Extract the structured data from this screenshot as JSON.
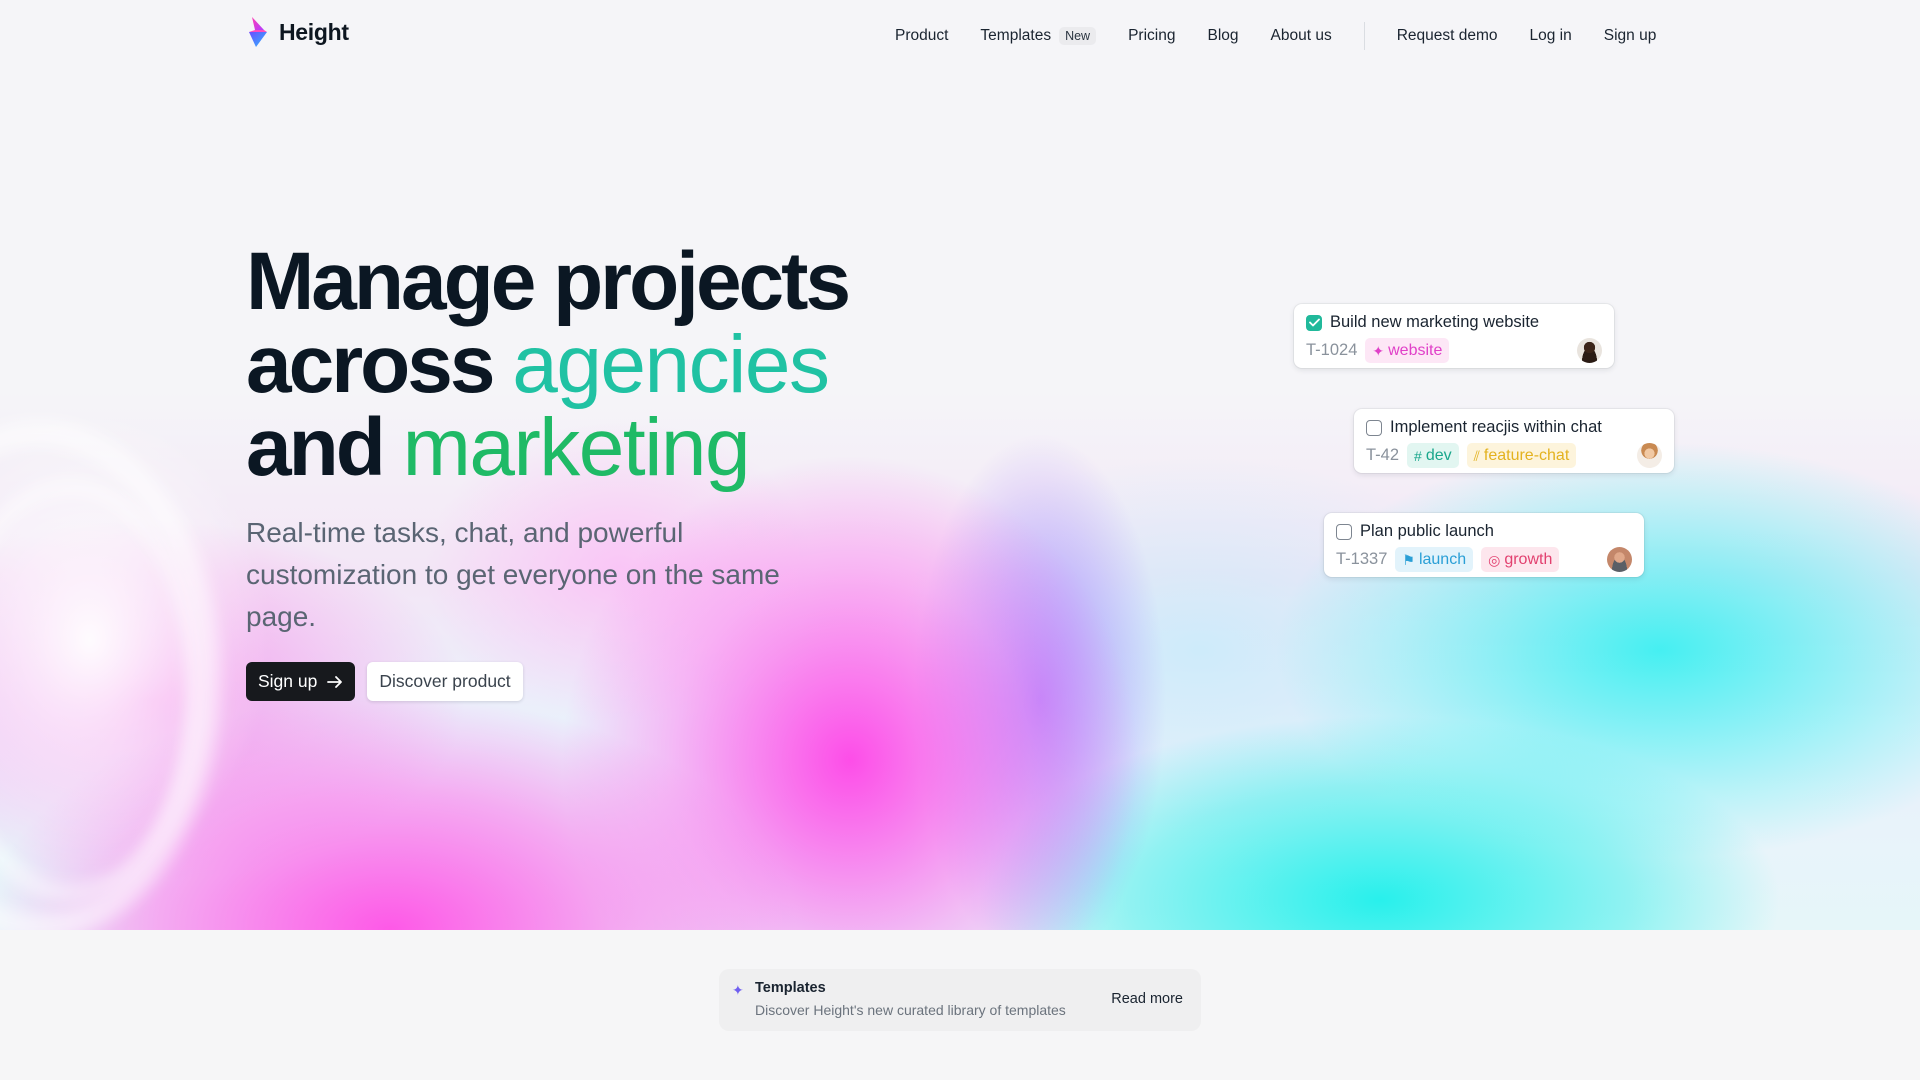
{
  "nav": {
    "brand": "Height",
    "links": {
      "product": "Product",
      "templates": "Templates",
      "templates_badge": "New",
      "pricing": "Pricing",
      "blog": "Blog",
      "about": "About us",
      "request_demo": "Request demo",
      "login": "Log in",
      "signup": "Sign up"
    }
  },
  "hero": {
    "headline": {
      "line1": "Manage projects",
      "line2_strong": "across",
      "line2_accent": "agencies",
      "line3_strong": "and",
      "line3_accent": "marketing"
    },
    "subcopy": "Real-time tasks, chat, and powerful customization to get everyone on the same page.",
    "primary_cta": "Sign up",
    "secondary_cta": "Discover product"
  },
  "tasks": [
    {
      "title": "Build new marketing website",
      "id": "T-1024",
      "done": true,
      "tags": [
        {
          "label": "website",
          "icon": "sparkle-icon",
          "color": "#e040c8",
          "bg": "#fde7f6"
        }
      ]
    },
    {
      "title": "Implement reacjis within chat",
      "id": "T-42",
      "done": false,
      "tags": [
        {
          "label": "dev",
          "icon": "hash-icon",
          "color": "#1aa78c",
          "bg": "#e2f6f1"
        },
        {
          "label": "feature-chat",
          "icon": "slashes-icon",
          "color": "#e3b21f",
          "bg": "#fdf4dc"
        }
      ]
    },
    {
      "title": "Plan public launch",
      "id": "T-1337",
      "done": false,
      "tags": [
        {
          "label": "launch",
          "icon": "flag-icon",
          "color": "#2a9fd6",
          "bg": "#e2f3fb"
        },
        {
          "label": "growth",
          "icon": "target-icon",
          "color": "#e2406f",
          "bg": "#fde6ed"
        }
      ]
    }
  ],
  "banner": {
    "title": "Templates",
    "description": "Discover Height's new curated library of templates",
    "link": "Read more"
  },
  "colors": {
    "accent_teal": "#20c2a3",
    "accent_green": "#1fba66",
    "dark": "#0b1723"
  }
}
